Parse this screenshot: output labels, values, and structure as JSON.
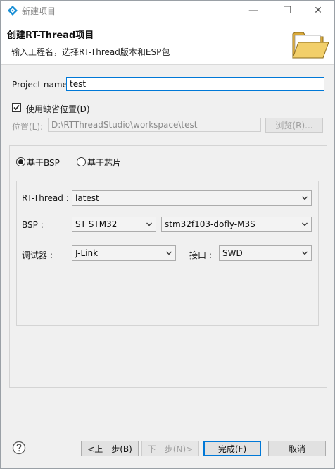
{
  "window": {
    "title": "新建项目",
    "minimize": "—",
    "maximize": "☐",
    "close": "✕"
  },
  "header": {
    "title": "创建RT-Thread项目",
    "description": "输入工程名，选择RT-Thread版本和ESP包"
  },
  "project": {
    "name_label": "Project name:",
    "name_value": "test"
  },
  "location": {
    "use_default_label": "使用缺省位置(D)",
    "use_default_checked": true,
    "label": "位置(L):",
    "path": "D:\\RTThreadStudio\\workspace\\test",
    "browse_label": "浏览(R)..."
  },
  "mode": {
    "options": [
      {
        "label": "基于BSP",
        "checked": true
      },
      {
        "label": "基于芯片",
        "checked": false
      }
    ]
  },
  "config": {
    "rtthread_label": "RT-Thread :",
    "rtthread_value": "latest",
    "bsp_label": "BSP :",
    "bsp_vendor_value": "ST STM32",
    "bsp_board_value": "stm32f103-dofly-M3S",
    "debugger_label": "调试器 :",
    "debugger_value": "J-Link",
    "interface_label": "接口 :",
    "interface_value": "SWD"
  },
  "footer": {
    "back_label": "<上一步(B)",
    "next_label": "下一步(N)>",
    "finish_label": "完成(F)",
    "cancel_label": "取消"
  },
  "colors": {
    "accent": "#0078d7",
    "app_icon": "#1a8fd6",
    "folder": "#e8c25a"
  }
}
